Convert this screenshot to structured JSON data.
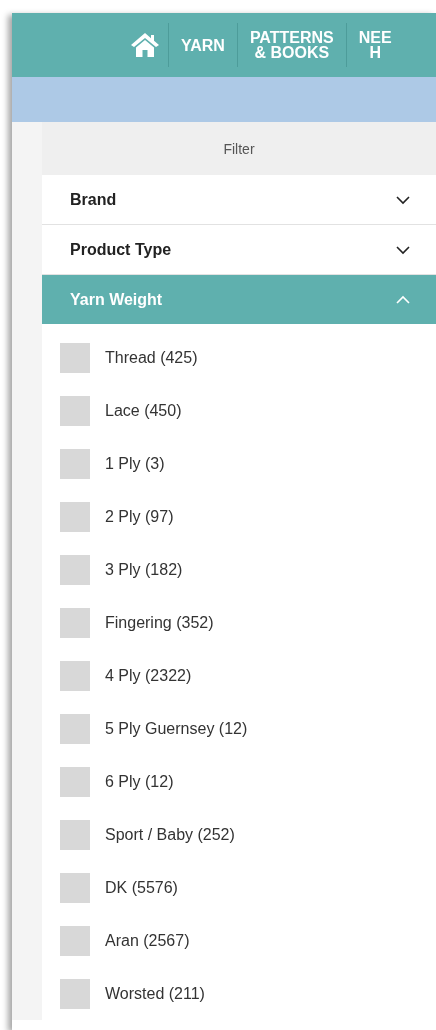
{
  "nav": {
    "items": [
      {
        "kind": "home"
      },
      {
        "kind": "text",
        "label": "YARN"
      },
      {
        "kind": "text",
        "label": "PATTERNS\n& BOOKS"
      },
      {
        "kind": "text",
        "label": "NEE\nH"
      }
    ]
  },
  "filter": {
    "title": "Filter",
    "sections": [
      {
        "label": "Brand",
        "expanded": false
      },
      {
        "label": "Product Type",
        "expanded": false
      },
      {
        "label": "Yarn Weight",
        "expanded": true,
        "options": [
          {
            "label": "Thread (425)",
            "checked": false
          },
          {
            "label": "Lace (450)",
            "checked": false
          },
          {
            "label": "1 Ply (3)",
            "checked": false
          },
          {
            "label": "2 Ply (97)",
            "checked": false
          },
          {
            "label": "3 Ply (182)",
            "checked": false
          },
          {
            "label": "Fingering (352)",
            "checked": false
          },
          {
            "label": "4 Ply (2322)",
            "checked": false
          },
          {
            "label": "5 Ply Guernsey (12)",
            "checked": false
          },
          {
            "label": "6 Ply (12)",
            "checked": false
          },
          {
            "label": "Sport / Baby (252)",
            "checked": false
          },
          {
            "label": "DK (5576)",
            "checked": false
          },
          {
            "label": "Aran (2567)",
            "checked": false
          },
          {
            "label": "Worsted (211)",
            "checked": false
          }
        ]
      }
    ]
  }
}
